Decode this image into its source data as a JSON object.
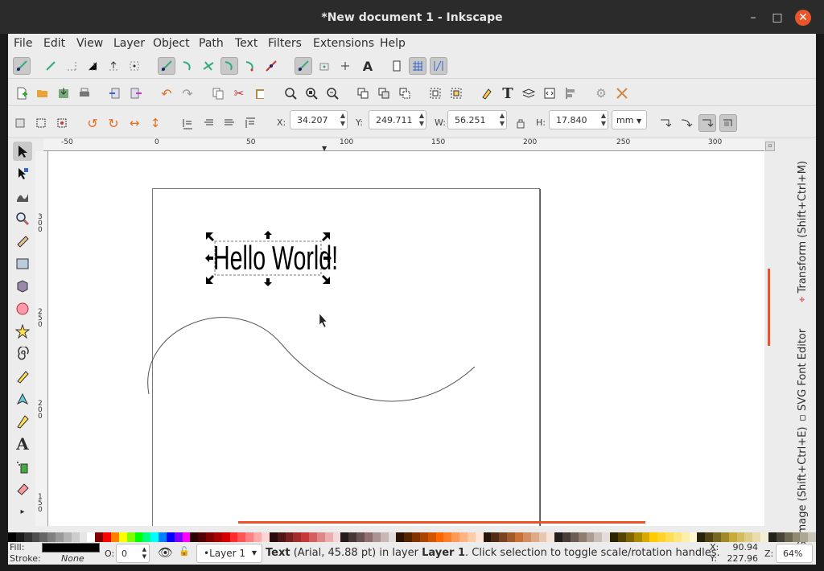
{
  "window": {
    "title": "*New document 1 - Inkscape",
    "min": "–",
    "max": "□",
    "close": "✕"
  },
  "menu": [
    "File",
    "Edit",
    "View",
    "Layer",
    "Object",
    "Path",
    "Text",
    "Filters",
    "Extensions",
    "Help"
  ],
  "context": {
    "x_label": "X:",
    "x_value": "34.207",
    "y_label": "Y:",
    "y_value": "249.711",
    "w_label": "W:",
    "w_value": "56.251",
    "h_label": "H:",
    "h_value": "17.840",
    "unit": "mm"
  },
  "ruler": {
    "h_labels": [
      "-50",
      "0",
      "50",
      "100",
      "150",
      "200",
      "250",
      "300"
    ],
    "v_labels": [
      "300",
      "250",
      "200",
      "150"
    ]
  },
  "canvas": {
    "text": "Hello World!"
  },
  "dock": {
    "transform": "Transform (Shift+Ctrl+M)",
    "svg_font": "SVG Font Editor",
    "png_image": "PNG Image (Shift+Ctrl+E)"
  },
  "status": {
    "fill_label": "Fill:",
    "stroke_label": "Stroke:",
    "stroke_value": "None",
    "opacity_label": "O:",
    "opacity_value": "0",
    "layer": "•Layer 1",
    "msg_bold": "Text",
    "msg_part1": "(Arial, 45.88 pt) in layer",
    "msg_layer": "Layer 1",
    "msg_part2": ". Click selection to toggle scale/rotation handles.",
    "cx_label": "X:",
    "cx": "90.94",
    "cy_label": "Y:",
    "cy": "227.96",
    "zoom_label": "Z:",
    "zoom": "64%"
  },
  "colors": {
    "accent": "#e9542a",
    "titlebar": "#2b2b2b",
    "panel": "#ececec"
  }
}
